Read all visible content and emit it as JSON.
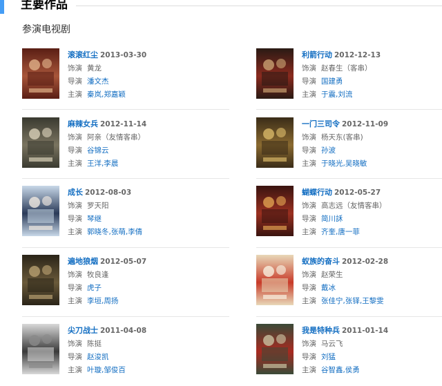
{
  "section": {
    "title": "主要作品"
  },
  "subsection": {
    "title": "参演电视剧"
  },
  "labels": {
    "role": "饰演",
    "director": "导演",
    "cast": "主演"
  },
  "colors": {
    "accent": "#459df5",
    "link": "#136ec2",
    "text": "#666666"
  },
  "works": [
    {
      "title": "滚滚红尘",
      "date": "2013-03-30",
      "role": "黄龙",
      "director": "潘文杰",
      "cast": [
        "秦岚",
        "郑嘉颖"
      ],
      "poster_colors": [
        "#5a1e14",
        "#a8563a",
        "#e0b088"
      ]
    },
    {
      "title": "利箭行动",
      "date": "2012-12-13",
      "role": "赵春生（客串）",
      "director": "国建勇",
      "cast": [
        "于震",
        "刘流"
      ],
      "poster_colors": [
        "#2a1a14",
        "#8a2a1e",
        "#c8a070"
      ]
    },
    {
      "title": "麻辣女兵",
      "date": "2012-11-14",
      "role": "阿亲（友情客串）",
      "director": "谷锦云",
      "cast": [
        "王洋",
        "李晨"
      ],
      "poster_colors": [
        "#3a3a30",
        "#7a7460",
        "#d8d0b8"
      ]
    },
    {
      "title": "一门三司令",
      "date": "2012-11-09",
      "role": "杨天东(客串)",
      "director": "孙波",
      "cast": [
        "于晓光",
        "吴晓敏"
      ],
      "poster_colors": [
        "#3a2c18",
        "#8a6a30",
        "#d8b868"
      ]
    },
    {
      "title": "成长",
      "date": "2012-08-03",
      "role": "罗天阳",
      "director": "琴继",
      "cast": [
        "郭晓冬",
        "张萌",
        "李倩"
      ],
      "poster_colors": [
        "#c8d8e8",
        "#2a3a58",
        "#f0e8e0"
      ]
    },
    {
      "title": "蝴蝶行动",
      "date": "2012-05-27",
      "role": "高志远（友情客串）",
      "director": "简川訸",
      "cast": [
        "齐奎",
        "唐一菲"
      ],
      "poster_colors": [
        "#3a1410",
        "#9a3020",
        "#e0a050"
      ]
    },
    {
      "title": "遍地狼烟",
      "date": "2012-05-07",
      "role": "牧良逢",
      "director": "虎子",
      "cast": [
        "李垣",
        "周扬"
      ],
      "poster_colors": [
        "#2a2418",
        "#6a5a3a",
        "#b8a070"
      ]
    },
    {
      "title": "蚁族的奋斗",
      "date": "2012-02-28",
      "role": "赵荣生",
      "director": "戴冰",
      "cast": [
        "张佳宁",
        "张铎",
        "王黎雯"
      ],
      "poster_colors": [
        "#e8d8b8",
        "#c83a28",
        "#f8f0e0"
      ]
    },
    {
      "title": "尖刀战士",
      "date": "2011-04-08",
      "role": "陈挺",
      "director": "赵浚凯",
      "cast": [
        "叶璇",
        "邹俊百"
      ],
      "poster_colors": [
        "#d8d8d8",
        "#3a3a3a",
        "#8a8a8a"
      ]
    },
    {
      "title": "我是特种兵",
      "date": "2011-01-14",
      "role": "马云飞",
      "director": "刘猛",
      "cast": [
        "谷智鑫",
        "侯勇"
      ],
      "poster_colors": [
        "#3a4a38",
        "#a82a20",
        "#c8c0a0"
      ]
    }
  ]
}
